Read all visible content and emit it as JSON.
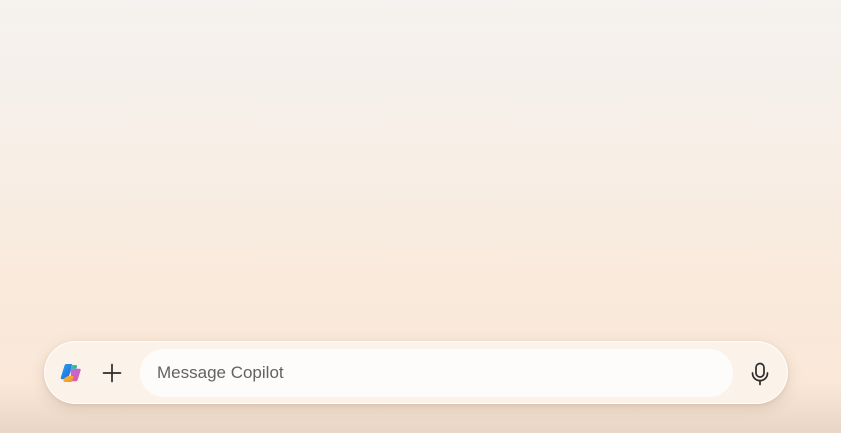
{
  "composer": {
    "input": {
      "placeholder": "Message Copilot",
      "value": ""
    },
    "buttons": {
      "copilot_icon": "copilot-logo-icon",
      "add_icon": "plus-icon",
      "mic_icon": "microphone-icon"
    }
  },
  "colors": {
    "background_top": "#f5f2ef",
    "background_bottom": "#fae6d6",
    "composer_bg": "#fbf3ea",
    "input_bg": "#fefcfb",
    "placeholder": "#626262",
    "icon": "#2b2b2b"
  }
}
